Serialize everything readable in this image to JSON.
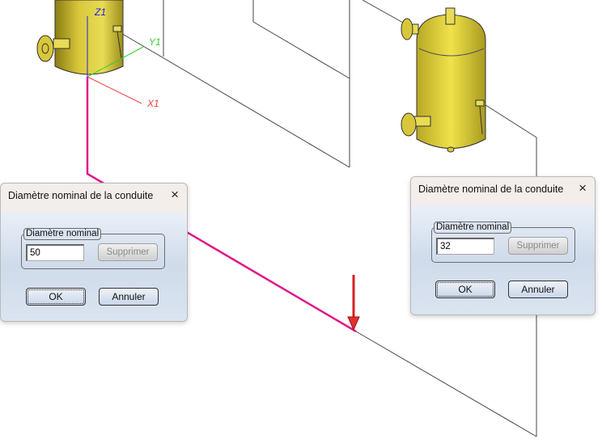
{
  "axes": {
    "z": "Z1",
    "y": "Y1",
    "x": "X1"
  },
  "colors": {
    "pipe": "#e0198a",
    "vessel": "#c8b830",
    "arrow": "#d42020"
  },
  "dialog_left": {
    "title": "Diamètre nominal de la conduite",
    "group_label": "Diamètre nominal",
    "value": "50",
    "delete_label": "Supprimer",
    "ok_label": "OK",
    "cancel_label": "Annuler",
    "close_icon": "×"
  },
  "dialog_right": {
    "title": "Diamètre nominal de la conduite",
    "group_label": "Diamètre nominal",
    "value": "32",
    "delete_label": "Supprimer",
    "ok_label": "OK",
    "cancel_label": "Annuler",
    "close_icon": "×"
  }
}
